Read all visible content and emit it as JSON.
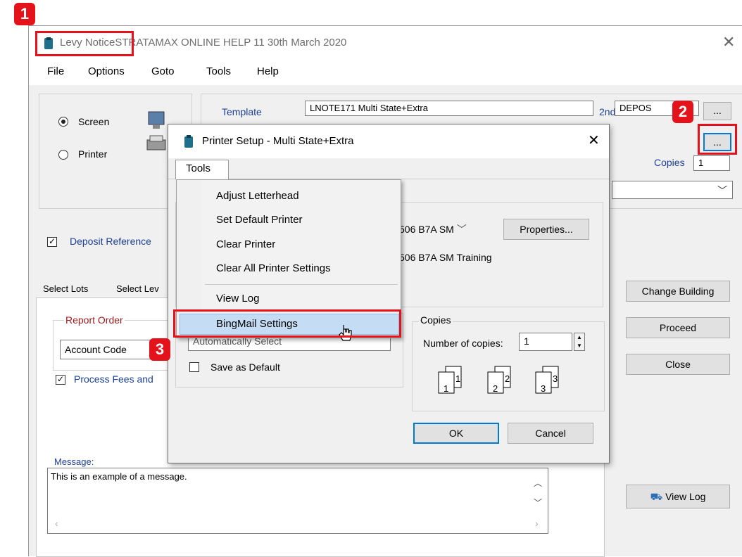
{
  "main_window": {
    "title_prefix": "Levy Notice",
    "title_rest": "STRATAMAX ONLINE HELP 11 30th March 2020",
    "menu": [
      "File",
      "Options",
      "Goto",
      "Tools",
      "Help"
    ],
    "output": {
      "screen": "Screen",
      "printer": "Printer",
      "selected": "Screen"
    },
    "template_label": "Template",
    "template_value": "LNOTE171 Multi State+Extra",
    "second_label": "2nd",
    "second_value": "DEPOS",
    "ellipsis": "...",
    "copies_label": "Copies",
    "copies_value": "1",
    "deposit_reference": "Deposit Reference",
    "tabs": [
      "Select Lots",
      "Select Lev"
    ],
    "report_order_label": "Report Order",
    "report_order_value": "Account Code",
    "process_fees": "Process Fees and",
    "message_label": "Message:",
    "message_text": "This is an example of a message.",
    "buttons": {
      "change_building": "Change Building",
      "proceed": "Proceed",
      "close": "Close",
      "view_log": "View Log"
    }
  },
  "dialog": {
    "title": "Printer Setup - Multi State+Extra",
    "menu_tab": "Tools",
    "printer_combo": "506 B7A SM",
    "properties": "Properties...",
    "printer_name": "506 B7A SM Training",
    "tray_value": "Automatically Select",
    "save_default": "Save as Default",
    "copies_group": "Copies",
    "number_of_copies_label": "Number of copies:",
    "number_of_copies_value": "1",
    "ok": "OK",
    "cancel": "Cancel"
  },
  "tools_menu": {
    "items": [
      "Adjust Letterhead",
      "Set Default Printer",
      "Clear Printer",
      "Clear All Printer Settings",
      "View Log",
      "BingMail Settings"
    ],
    "highlighted": "BingMail Settings"
  },
  "markers": [
    "1",
    "2",
    "3"
  ],
  "colors": {
    "marker": "#e4131b",
    "highlight": "#c4dcf4",
    "accent_blue": "#1c3f94"
  }
}
